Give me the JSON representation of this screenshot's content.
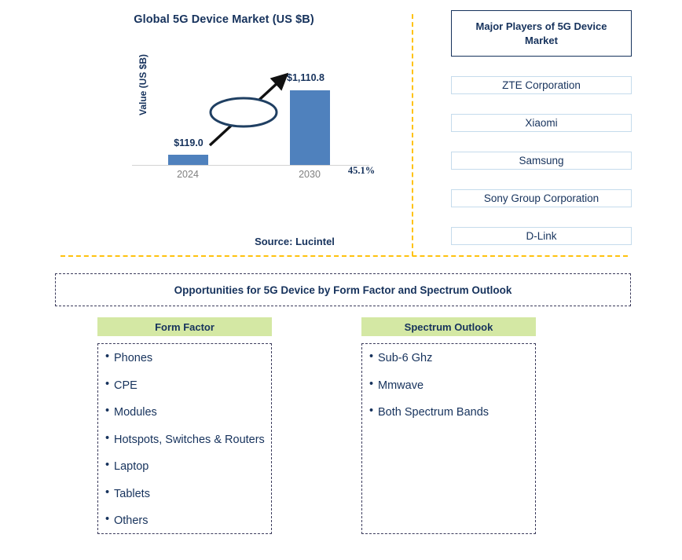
{
  "chart_panel": {
    "title": "Global 5G Device Market (US $B)",
    "source": "Source: Lucintel"
  },
  "chart_data": {
    "type": "bar",
    "title": "Global 5G Device Market (US $B)",
    "categories": [
      "2024",
      "2030"
    ],
    "values": [
      119.0,
      1110.8
    ],
    "value_labels": [
      "$119.0",
      "$1,110.8"
    ],
    "xlabel": "",
    "ylabel": "Value (US $B)",
    "ylim": [
      0,
      1250
    ],
    "grid": false,
    "legend": "none",
    "bar_color": "#4f81bd",
    "annotations": [
      {
        "label": "45.1%",
        "type": "cagr-callout",
        "from": "2024",
        "to": "2030"
      }
    ]
  },
  "players_panel": {
    "header": "Major Players of 5G Device Market",
    "items": [
      "ZTE Corporation",
      "Xiaomi",
      "Samsung",
      "Sony Group Corporation",
      "D-Link"
    ]
  },
  "opportunities": {
    "banner": "Opportunities for 5G Device by Form Factor and Spectrum Outlook",
    "columns": [
      {
        "header": "Form Factor",
        "items": [
          "Phones",
          "CPE",
          "Modules",
          "Hotspots, Switches & Routers",
          "Laptop",
          "Tablets",
          "Others"
        ]
      },
      {
        "header": "Spectrum Outlook",
        "items": [
          "Sub-6 Ghz",
          "Mmwave",
          "Both Spectrum Bands"
        ]
      }
    ]
  },
  "bullet_glyph": "•",
  "colors": {
    "navy": "#16325c",
    "bar_blue": "#4f81bd",
    "amber_divider": "#ffc20e",
    "green_header": "#d4e8a4",
    "light_blue_border": "#c5dbec"
  }
}
